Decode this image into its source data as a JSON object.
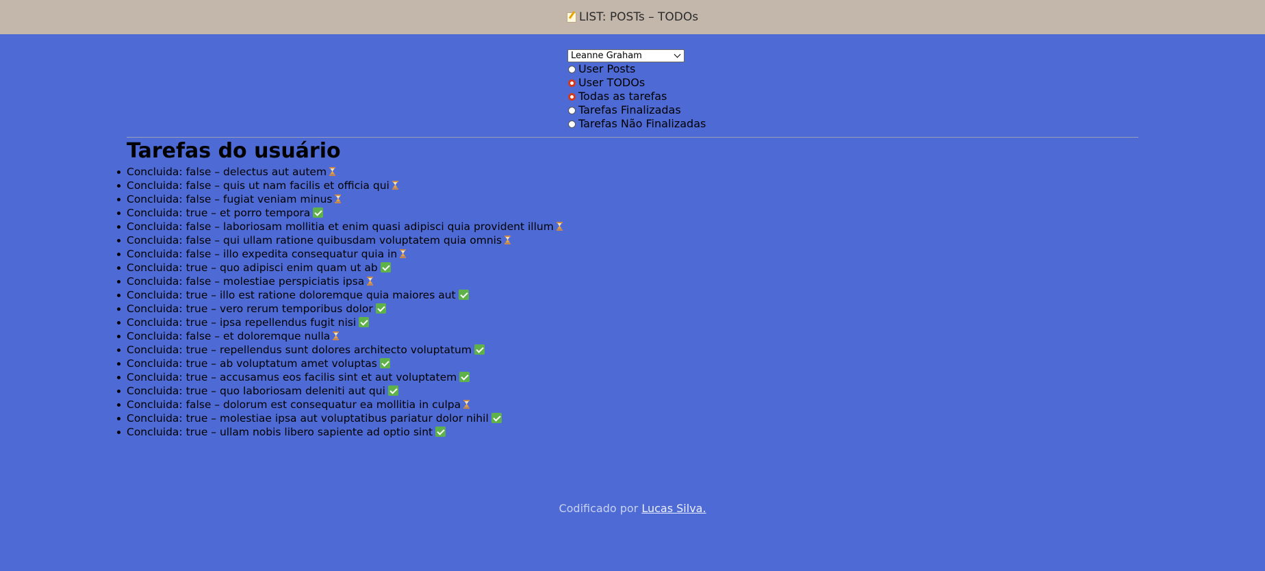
{
  "header": {
    "title": "LIST: POSTs – TODOs",
    "icon": "memo-icon"
  },
  "controls": {
    "user_select": {
      "selected": "Leanne Graham"
    },
    "radios": [
      {
        "label": "User Posts",
        "checked": false
      },
      {
        "label": "User TODOs",
        "checked": true
      },
      {
        "label": "Todas as tarefas",
        "checked": true
      },
      {
        "label": "Tarefas Finalizadas",
        "checked": false
      },
      {
        "label": "Tarefas Não Finalizadas",
        "checked": false
      }
    ]
  },
  "main": {
    "title": "Tarefas do usuário",
    "todos": [
      {
        "text": "Concluida: false – delectus aut autem",
        "icon": "hourglass-icon"
      },
      {
        "text": "Concluida: false – quis ut nam facilis et officia qui",
        "icon": "hourglass-icon"
      },
      {
        "text": "Concluida: false – fugiat veniam minus",
        "icon": "hourglass-icon"
      },
      {
        "text": "Concluida: true – et porro tempora",
        "icon": "check-mark-icon"
      },
      {
        "text": "Concluida: false – laboriosam mollitia et enim quasi adipisci quia provident illum",
        "icon": "hourglass-icon"
      },
      {
        "text": "Concluida: false – qui ullam ratione quibusdam voluptatem quia omnis",
        "icon": "hourglass-icon"
      },
      {
        "text": "Concluida: false – illo expedita consequatur quia in",
        "icon": "hourglass-icon"
      },
      {
        "text": "Concluida: true – quo adipisci enim quam ut ab",
        "icon": "check-mark-icon"
      },
      {
        "text": "Concluida: false – molestiae perspiciatis ipsa",
        "icon": "hourglass-icon"
      },
      {
        "text": "Concluida: true – illo est ratione doloremque quia maiores aut",
        "icon": "check-mark-icon"
      },
      {
        "text": "Concluida: true – vero rerum temporibus dolor",
        "icon": "check-mark-icon"
      },
      {
        "text": "Concluida: true – ipsa repellendus fugit nisi",
        "icon": "check-mark-icon"
      },
      {
        "text": "Concluida: false – et doloremque nulla",
        "icon": "hourglass-icon"
      },
      {
        "text": "Concluida: true – repellendus sunt dolores architecto voluptatum",
        "icon": "check-mark-icon"
      },
      {
        "text": "Concluida: true – ab voluptatum amet voluptas",
        "icon": "check-mark-icon"
      },
      {
        "text": "Concluida: true – accusamus eos facilis sint et aut voluptatem",
        "icon": "check-mark-icon"
      },
      {
        "text": "Concluida: true – quo laboriosam deleniti aut qui",
        "icon": "check-mark-icon"
      },
      {
        "text": "Concluida: false – dolorum est consequatur ea mollitia in culpa",
        "icon": "hourglass-icon"
      },
      {
        "text": "Concluida: true – molestiae ipsa aut voluptatibus pariatur dolor nihil",
        "icon": "check-mark-icon"
      },
      {
        "text": "Concluida: true – ullam nobis libero sapiente ad optio sint",
        "icon": "check-mark-icon"
      }
    ]
  },
  "footer": {
    "prefix": "Codificado por",
    "author_link": "Lucas Silva."
  },
  "colors": {
    "background": "#4e6bd5",
    "header_bg": "#c3b6aa",
    "radio_checked": "#d23a1f",
    "check_green": "#5fb24a"
  }
}
